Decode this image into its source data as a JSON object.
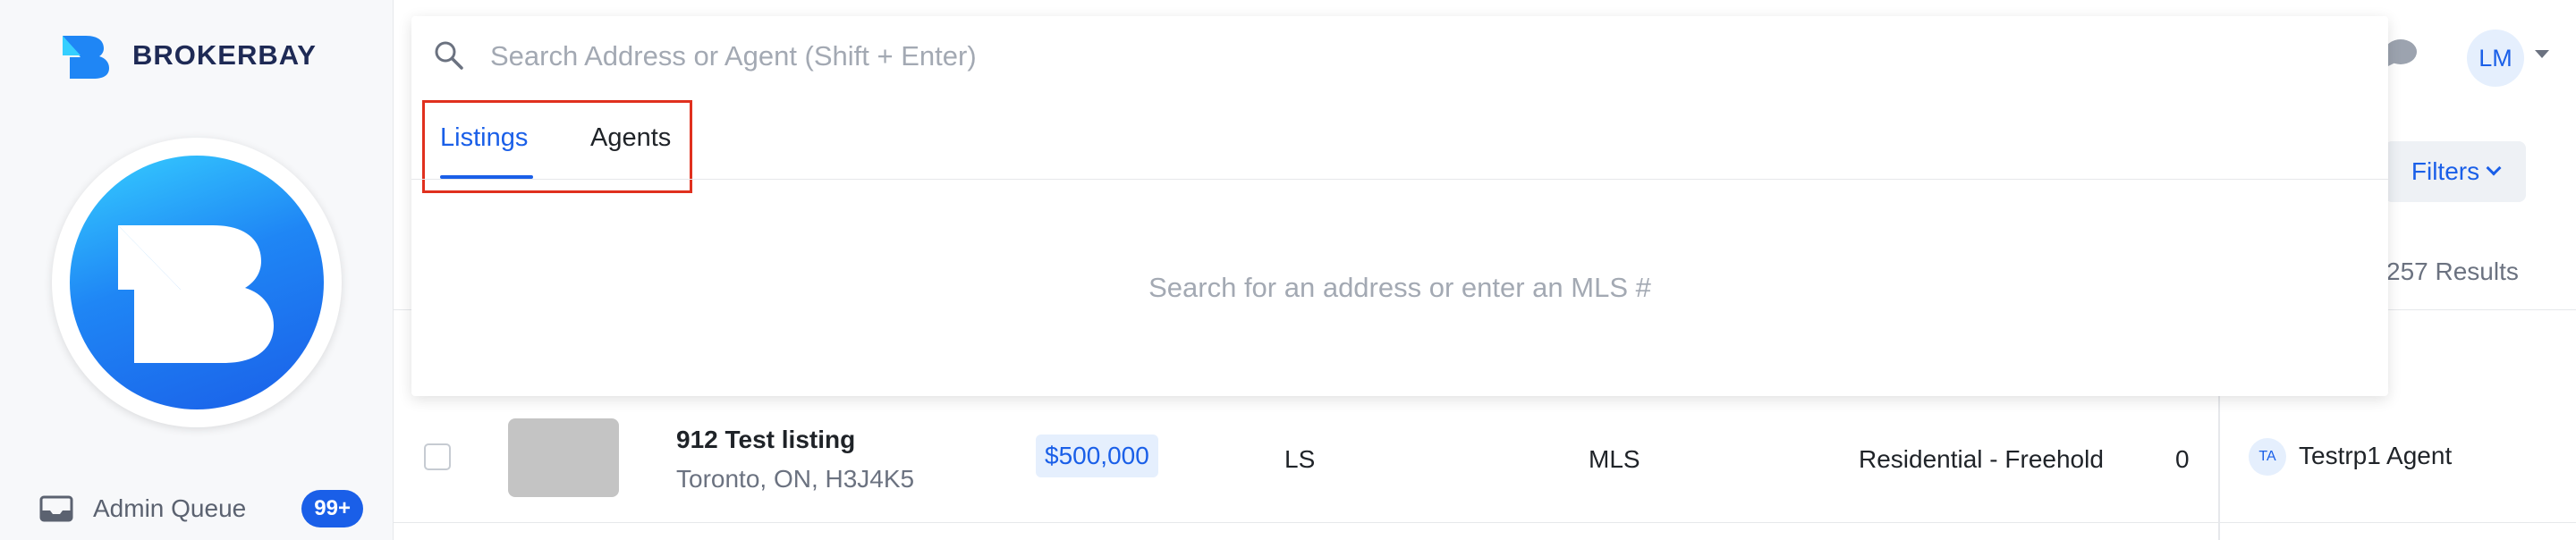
{
  "brand": {
    "name_part1": "BROKER",
    "name_part2": "BAY"
  },
  "sidebar": {
    "admin_queue_label": "Admin Queue",
    "admin_queue_badge": "99+"
  },
  "header": {
    "user_initials": "LM",
    "chat_icon": "chat-bubble-icon"
  },
  "search": {
    "placeholder": "Search Address or Agent (Shift + Enter)",
    "value": "",
    "tabs": [
      {
        "label": "Listings",
        "active": true
      },
      {
        "label": "Agents",
        "active": false
      }
    ],
    "empty_hint": "Search for an address or enter an MLS #"
  },
  "toolbar": {
    "filters_label": "Filters",
    "results_count": "257 Results"
  },
  "table": {
    "rows": [
      {
        "title": "912 Test listing",
        "address": "Toronto, ON, H3J4K5",
        "price": "$500,000",
        "col_ls": "LS",
        "col_mls": "MLS",
        "property_type": "Residential - Freehold",
        "count": "0",
        "agent_initials": "TA",
        "agent_name": "Testrp1 Agent"
      }
    ]
  },
  "colors": {
    "accent": "#1a5fe8",
    "highlight_box": "#e0301e",
    "brand_navy": "#1e2a55"
  }
}
